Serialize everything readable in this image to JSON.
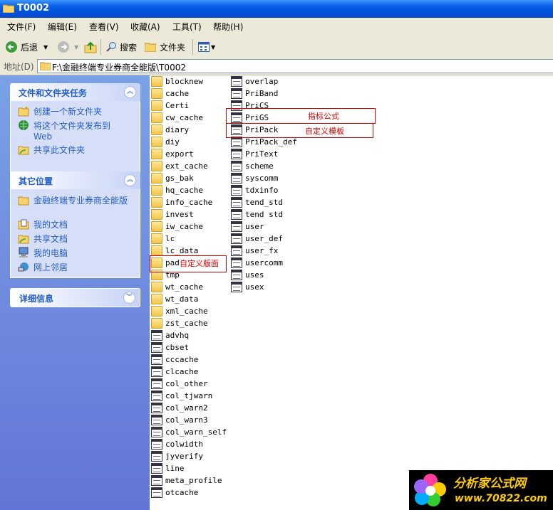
{
  "window": {
    "title": "T0002"
  },
  "menu": [
    "文件(F)",
    "编辑(E)",
    "查看(V)",
    "收藏(A)",
    "工具(T)",
    "帮助(H)"
  ],
  "toolbar": {
    "back": "后退",
    "search": "搜索",
    "folders": "文件夹"
  },
  "address": {
    "label": "地址(D)",
    "path": "F:\\金融终端专业券商全能版\\T0002"
  },
  "tasks_panel": {
    "title": "文件和文件夹任务",
    "items": [
      "创建一个新文件夹",
      "将这个文件夹发布到 Web",
      "共享此文件夹"
    ]
  },
  "places_panel": {
    "title": "其它位置",
    "items": [
      "金融终端专业券商全能版",
      "我的文档",
      "共享文档",
      "我的电脑",
      "网上邻居"
    ]
  },
  "details_panel": {
    "title": "详细信息"
  },
  "files_col1": [
    {
      "name": "blocknew",
      "type": "folder"
    },
    {
      "name": "cache",
      "type": "folder"
    },
    {
      "name": "Certi",
      "type": "folder"
    },
    {
      "name": "cw_cache",
      "type": "folder"
    },
    {
      "name": "diary",
      "type": "folder"
    },
    {
      "name": "diy",
      "type": "folder"
    },
    {
      "name": "export",
      "type": "folder"
    },
    {
      "name": "ext_cache",
      "type": "folder"
    },
    {
      "name": "gs_bak",
      "type": "folder"
    },
    {
      "name": "hq_cache",
      "type": "folder"
    },
    {
      "name": "info_cache",
      "type": "folder"
    },
    {
      "name": "invest",
      "type": "folder"
    },
    {
      "name": "iw_cache",
      "type": "folder"
    },
    {
      "name": "lc",
      "type": "folder"
    },
    {
      "name": "lc_data",
      "type": "folder"
    },
    {
      "name": "pad",
      "type": "folder"
    },
    {
      "name": "tmp",
      "type": "folder"
    },
    {
      "name": "wt_cache",
      "type": "folder"
    },
    {
      "name": "wt_data",
      "type": "folder"
    },
    {
      "name": "xml_cache",
      "type": "folder"
    },
    {
      "name": "zst_cache",
      "type": "folder"
    },
    {
      "name": "advhq",
      "type": "file"
    },
    {
      "name": "cbset",
      "type": "file"
    },
    {
      "name": "cccache",
      "type": "file"
    },
    {
      "name": "clcache",
      "type": "file"
    },
    {
      "name": "col_other",
      "type": "file"
    },
    {
      "name": "col_tjwarn",
      "type": "file"
    },
    {
      "name": "col_warn2",
      "type": "file"
    },
    {
      "name": "col_warn3",
      "type": "file"
    },
    {
      "name": "col_warn_self",
      "type": "file"
    },
    {
      "name": "colwidth",
      "type": "file"
    },
    {
      "name": "jyverify",
      "type": "file"
    },
    {
      "name": "line",
      "type": "file"
    },
    {
      "name": "meta_profile",
      "type": "file"
    },
    {
      "name": "otcache",
      "type": "file"
    }
  ],
  "files_col2": [
    {
      "name": "overlap",
      "type": "file"
    },
    {
      "name": "PriBand",
      "type": "file"
    },
    {
      "name": "PriCS",
      "type": "file"
    },
    {
      "name": "PriGS",
      "type": "file"
    },
    {
      "name": "PriPack",
      "type": "file"
    },
    {
      "name": "PriPack_def",
      "type": "file"
    },
    {
      "name": "PriText",
      "type": "file"
    },
    {
      "name": "scheme",
      "type": "file"
    },
    {
      "name": "syscomm",
      "type": "file"
    },
    {
      "name": "tdxinfo",
      "type": "file"
    },
    {
      "name": "tend_std",
      "type": "file"
    },
    {
      "name": "tend std",
      "type": "file"
    },
    {
      "name": "user",
      "type": "file"
    },
    {
      "name": "user_def",
      "type": "file"
    },
    {
      "name": "user_fx",
      "type": "file"
    },
    {
      "name": "usercomm",
      "type": "file"
    },
    {
      "name": "uses",
      "type": "file"
    },
    {
      "name": "usex",
      "type": "file"
    }
  ],
  "annotations": {
    "prigs": "指标公式",
    "pripack": "自定义模板",
    "pad": "自定义版面"
  },
  "logo": {
    "text": "分析家公式网",
    "url": "www.70822.com"
  },
  "colors": {
    "titlebar": "#0a5fe8",
    "panel_link": "#215dc6",
    "annotation": "#dd0000"
  }
}
